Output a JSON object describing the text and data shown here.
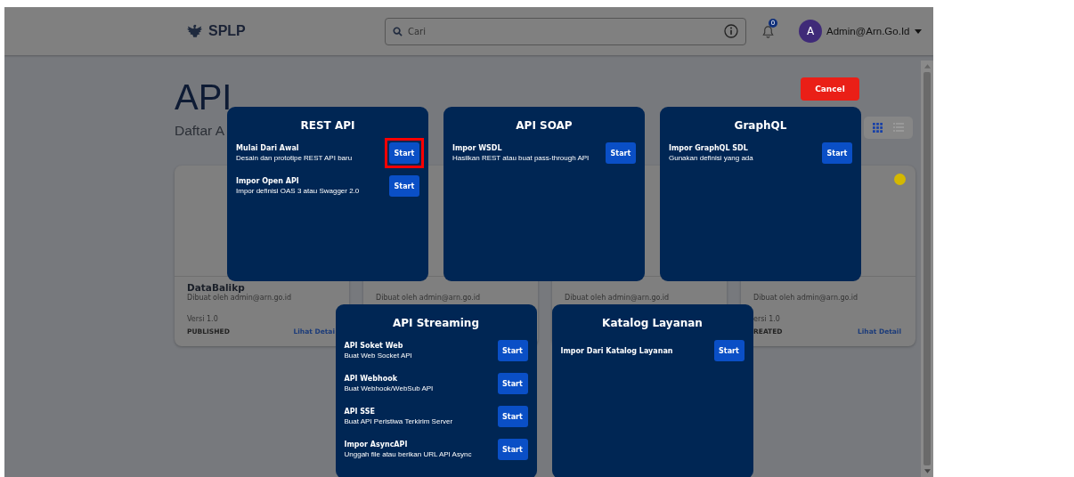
{
  "header": {
    "logo": "SPLP",
    "search": {
      "placeholder": "Cari"
    },
    "notifications": {
      "badge": "0"
    },
    "user": {
      "avatar": "A",
      "name": "Admin@Arn.Go.Id"
    }
  },
  "page": {
    "title": "API",
    "subtitle": "Daftar A",
    "view_modes": [
      {
        "kind": "grid",
        "selected": true
      },
      {
        "kind": "list",
        "selected": false
      }
    ]
  },
  "cards": [
    {
      "name": "DataBalikp",
      "author": "Dibuat oleh admin@arn.go.id",
      "version": "Versi 1.0",
      "status": "PUBLISHED",
      "link": "Lihat Detai"
    },
    {
      "author": "Dibuat oleh admin@arn.go.id"
    },
    {
      "author": "Dibuat oleh admin@arn.go.id"
    },
    {
      "author": "Dibuat oleh admin@arn.go.id",
      "version": "ersi 1.0",
      "status": "REATED",
      "link": "Lihat Detail",
      "color": "#d4b800"
    }
  ],
  "dialog": {
    "cancel": "Cancel",
    "groups": [
      {
        "title": "REST API",
        "options": [
          {
            "name": "Mulai Dari Awal",
            "description": "Desain dan prototipe REST API baru",
            "button": "Start",
            "highlighted": true
          },
          {
            "name": "Impor Open API",
            "description": "Impor definisi OAS 3 atau Swagger 2.0",
            "button": "Start",
            "highlighted": false
          }
        ]
      },
      {
        "title": "API SOAP",
        "options": [
          {
            "name": "Impor WSDL",
            "description": "Hasilkan REST atau buat pass-through API",
            "button": "Start",
            "highlighted": false
          }
        ]
      },
      {
        "title": "GraphQL",
        "options": [
          {
            "name": "Impor GraphQL SDL",
            "description": "Gunakan definisi yang ada",
            "button": "Start",
            "highlighted": false
          }
        ]
      },
      {
        "title": "API Streaming",
        "options": [
          {
            "name": "API Soket Web",
            "description": "Buat Web Socket API",
            "button": "Start",
            "highlighted": false
          },
          {
            "name": "API Webhook",
            "description": "Buat Webhook/WebSub API",
            "button": "Start",
            "highlighted": false
          },
          {
            "name": "API SSE",
            "description": "Buat API Peristiwa Terkirim Server",
            "button": "Start",
            "highlighted": false
          },
          {
            "name": "Impor AsyncAPI",
            "description": "Unggah file atau berikan URL API Async",
            "button": "Start",
            "highlighted": false
          }
        ]
      },
      {
        "title": "Katalog Layanan",
        "options": [
          {
            "name": "Impor Dari Katalog Layanan",
            "button": "Start",
            "highlighted": false
          }
        ]
      }
    ]
  }
}
